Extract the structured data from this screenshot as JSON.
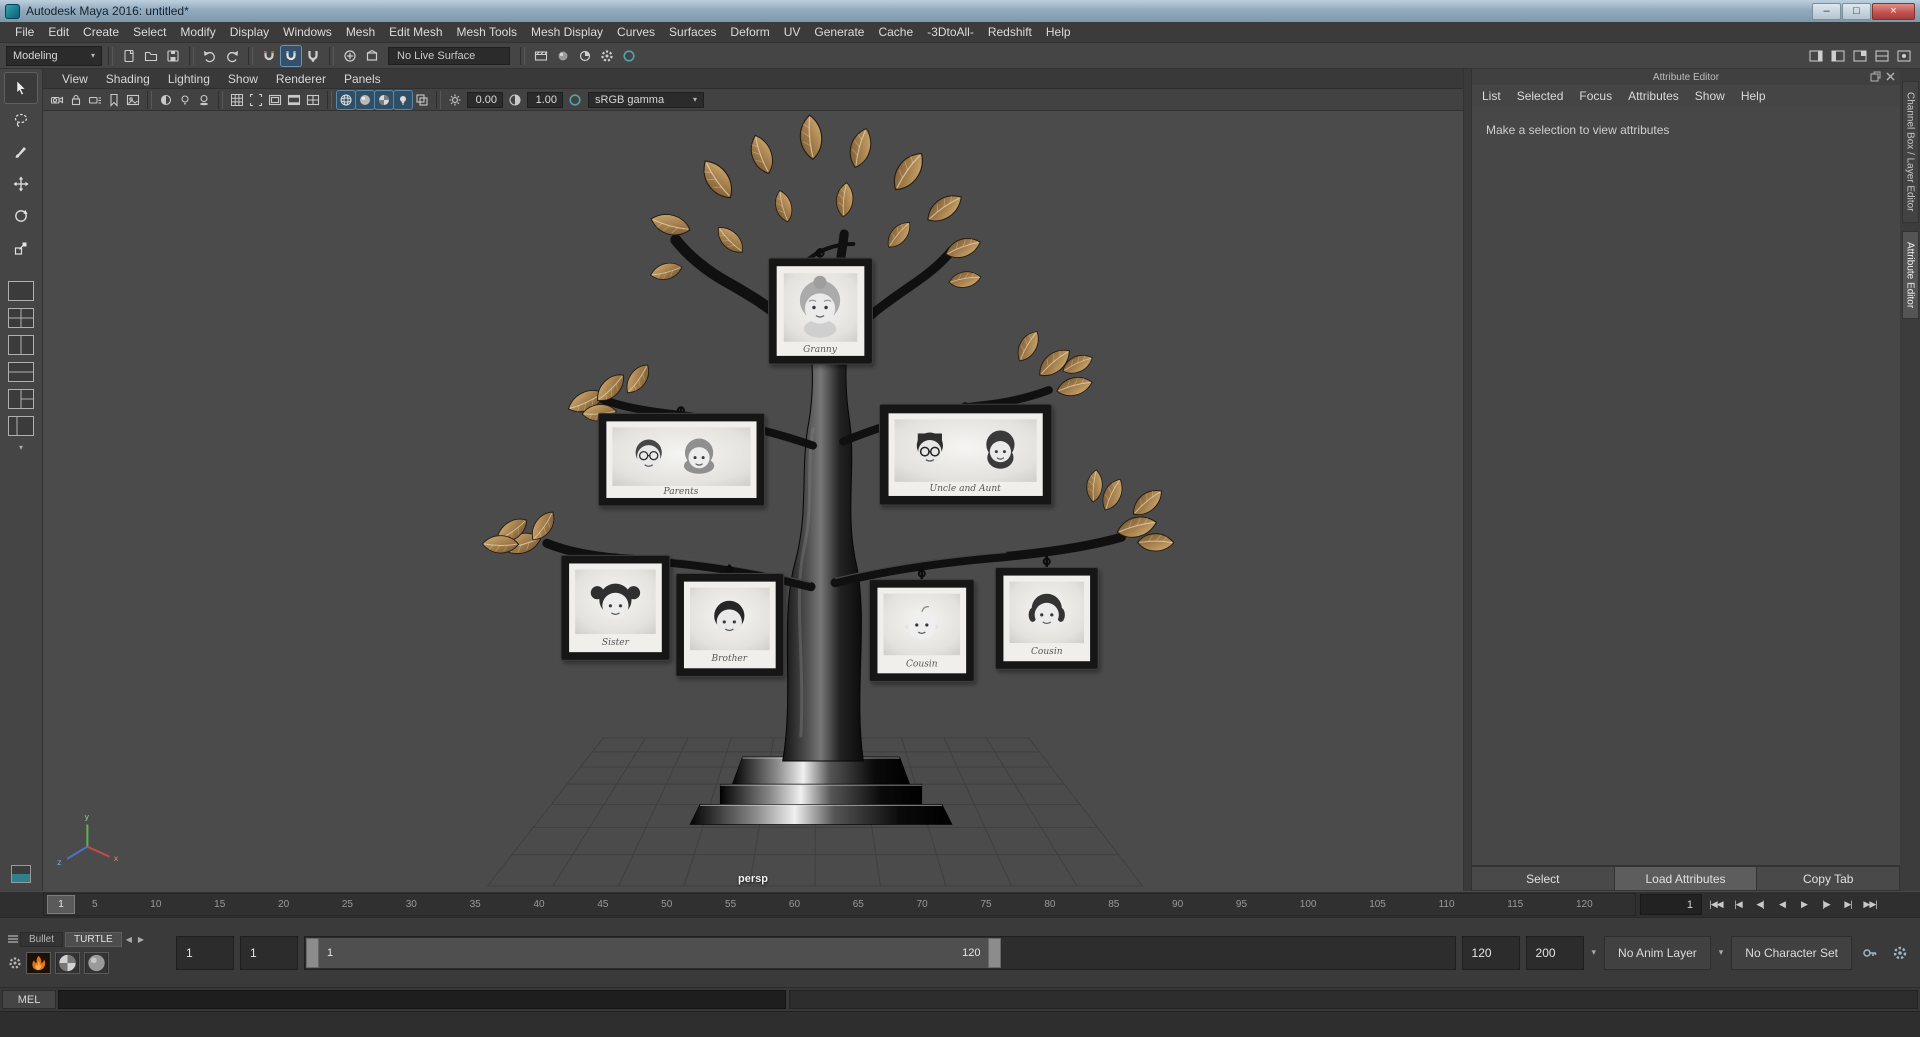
{
  "window": {
    "title": "Autodesk Maya 2016: untitled*",
    "controls": {
      "minimize": "–",
      "maximize": "□",
      "close": "×"
    }
  },
  "menu_bar": {
    "items": [
      "File",
      "Edit",
      "Create",
      "Select",
      "Modify",
      "Display",
      "Windows",
      "Mesh",
      "Edit Mesh",
      "Mesh Tools",
      "Mesh Display",
      "Curves",
      "Surfaces",
      "Deform",
      "UV",
      "Generate",
      "Cache",
      "-3DtoAll-",
      "Redshift",
      "Help"
    ]
  },
  "status_line": {
    "menu_set": "Modeling",
    "live_surface": "No Live Surface"
  },
  "panel_menu": {
    "items": [
      "View",
      "Shading",
      "Lighting",
      "Show",
      "Renderer",
      "Panels"
    ]
  },
  "panel_toolbar": {
    "exposure": "0.00",
    "gamma": "1.00",
    "view_transform": "sRGB gamma"
  },
  "viewport": {
    "camera_label": "persp",
    "axis": {
      "x": "x",
      "y": "y",
      "z": "z"
    },
    "frames": [
      {
        "label": "Granny"
      },
      {
        "label": "Parents"
      },
      {
        "label": "Uncle and Aunt"
      },
      {
        "label": "Sister"
      },
      {
        "label": "Brother"
      },
      {
        "label": "Cousin"
      },
      {
        "label": "Cousin"
      }
    ]
  },
  "attribute_editor": {
    "title": "Attribute Editor",
    "menu": [
      "List",
      "Selected",
      "Focus",
      "Attributes",
      "Show",
      "Help"
    ],
    "message": "Make a selection to view attributes",
    "footer": {
      "select": "Select",
      "load": "Load Attributes",
      "copy": "Copy Tab"
    }
  },
  "side_tabs": {
    "channel_box": "Channel Box / Layer Editor",
    "attribute_editor": "Attribute Editor"
  },
  "timeline": {
    "ticks": [
      "5",
      "10",
      "15",
      "20",
      "25",
      "30",
      "35",
      "40",
      "45",
      "50",
      "55",
      "60",
      "65",
      "70",
      "75",
      "80",
      "85",
      "90",
      "95",
      "100",
      "105",
      "110",
      "115",
      "120"
    ],
    "playhead": "1",
    "current_time": "1",
    "playback": [
      {
        "name": "go-to-start",
        "glyph": "|◀◀"
      },
      {
        "name": "step-back-frame",
        "glyph": "|◀"
      },
      {
        "name": "step-back-key",
        "glyph": "◀|"
      },
      {
        "name": "play-backwards",
        "glyph": "◀"
      },
      {
        "name": "play-forwards",
        "glyph": "▶"
      },
      {
        "name": "step-forward-key",
        "glyph": "|▶"
      },
      {
        "name": "step-forward-frame",
        "glyph": "▶|"
      },
      {
        "name": "go-to-end",
        "glyph": "▶▶|"
      }
    ]
  },
  "range_slider": {
    "tabs": {
      "bullet": "Bullet",
      "turtle": "TURTLE"
    },
    "anim_start": "1",
    "playback_start": "1",
    "bar_start": "1",
    "bar_end": "120",
    "playback_end": "120",
    "anim_end": "200",
    "anim_layer": "No Anim Layer",
    "character_set": "No Character Set"
  },
  "command_line": {
    "label": "MEL"
  },
  "icons": {
    "caret": "▾",
    "prev": "◀",
    "next": "▶"
  }
}
